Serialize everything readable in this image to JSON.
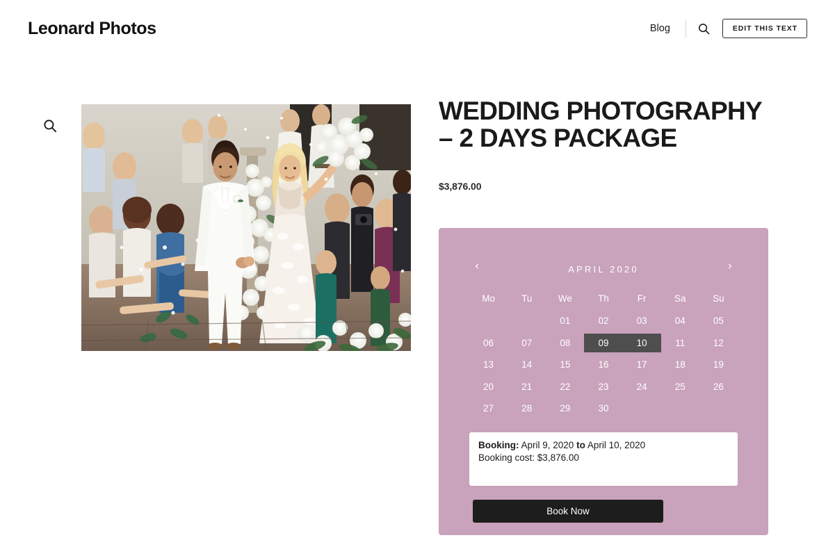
{
  "header": {
    "site_title": "Leonard Photos",
    "nav_link": "Blog",
    "search_icon": "search-icon",
    "edit_button": "EDIT THIS TEXT"
  },
  "gallery": {
    "zoom_icon": "magnifier-icon",
    "image_alt": "Bride and groom walking down flower-lined aisle surrounded by guests"
  },
  "product": {
    "title": "WEDDING PHOTOGRAPHY – 2 DAYS PACKAGE",
    "price": "$3,876.00"
  },
  "calendar": {
    "prev_arrow": "‹",
    "next_arrow": "›",
    "month_label": "APRIL 2020",
    "weekdays": [
      "Mo",
      "Tu",
      "We",
      "Th",
      "Fr",
      "Sa",
      "Su"
    ],
    "weeks": [
      [
        "",
        "",
        "01",
        "02",
        "03",
        "04",
        "05"
      ],
      [
        "06",
        "07",
        "08",
        "09",
        "10",
        "11",
        "12"
      ],
      [
        "13",
        "14",
        "15",
        "16",
        "17",
        "18",
        "19"
      ],
      [
        "20",
        "21",
        "22",
        "23",
        "24",
        "25",
        "26"
      ],
      [
        "27",
        "28",
        "29",
        "30",
        "",
        "",
        ""
      ]
    ],
    "selected_days": [
      "09",
      "10"
    ],
    "selected_week_index": 1,
    "panel_color": "#c9a2bb",
    "selection_color": "#4e4e4e"
  },
  "booking": {
    "label": "Booking:",
    "start_date": "April 9, 2020",
    "to_label": "to",
    "end_date": "April 10, 2020",
    "cost_line": "Booking cost: $3,876.00",
    "book_now_label": "Book Now"
  }
}
